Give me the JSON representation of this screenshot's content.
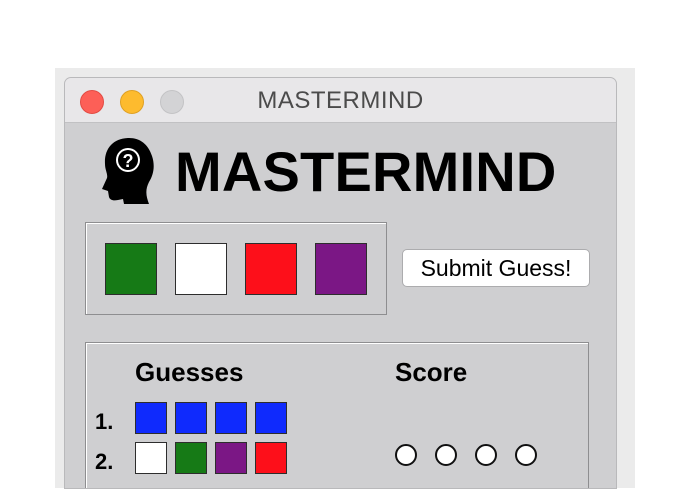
{
  "window": {
    "title": "MASTERMIND"
  },
  "logo": {
    "icon": "head-question-icon",
    "title": "MASTERMIND"
  },
  "guess_selector": {
    "pegs": [
      {
        "color_name": "green",
        "color": "#167a16"
      },
      {
        "color_name": "white",
        "color": "#ffffff"
      },
      {
        "color_name": "red",
        "color": "#fd0f1a"
      },
      {
        "color_name": "purple",
        "color": "#7b1785"
      }
    ],
    "submit_label": "Submit Guess!"
  },
  "history": {
    "guesses_header": "Guesses",
    "score_header": "Score",
    "rows": [
      {
        "label": "1.",
        "pegs": [
          "#0f2afd",
          "#0f2afd",
          "#0f2afd",
          "#0f2afd"
        ],
        "score": []
      },
      {
        "label": "2.",
        "pegs": [
          "#ffffff",
          "#167a16",
          "#7b1785",
          "#fd0f1a"
        ],
        "score": [
          "white",
          "white",
          "white",
          "white"
        ]
      }
    ]
  }
}
